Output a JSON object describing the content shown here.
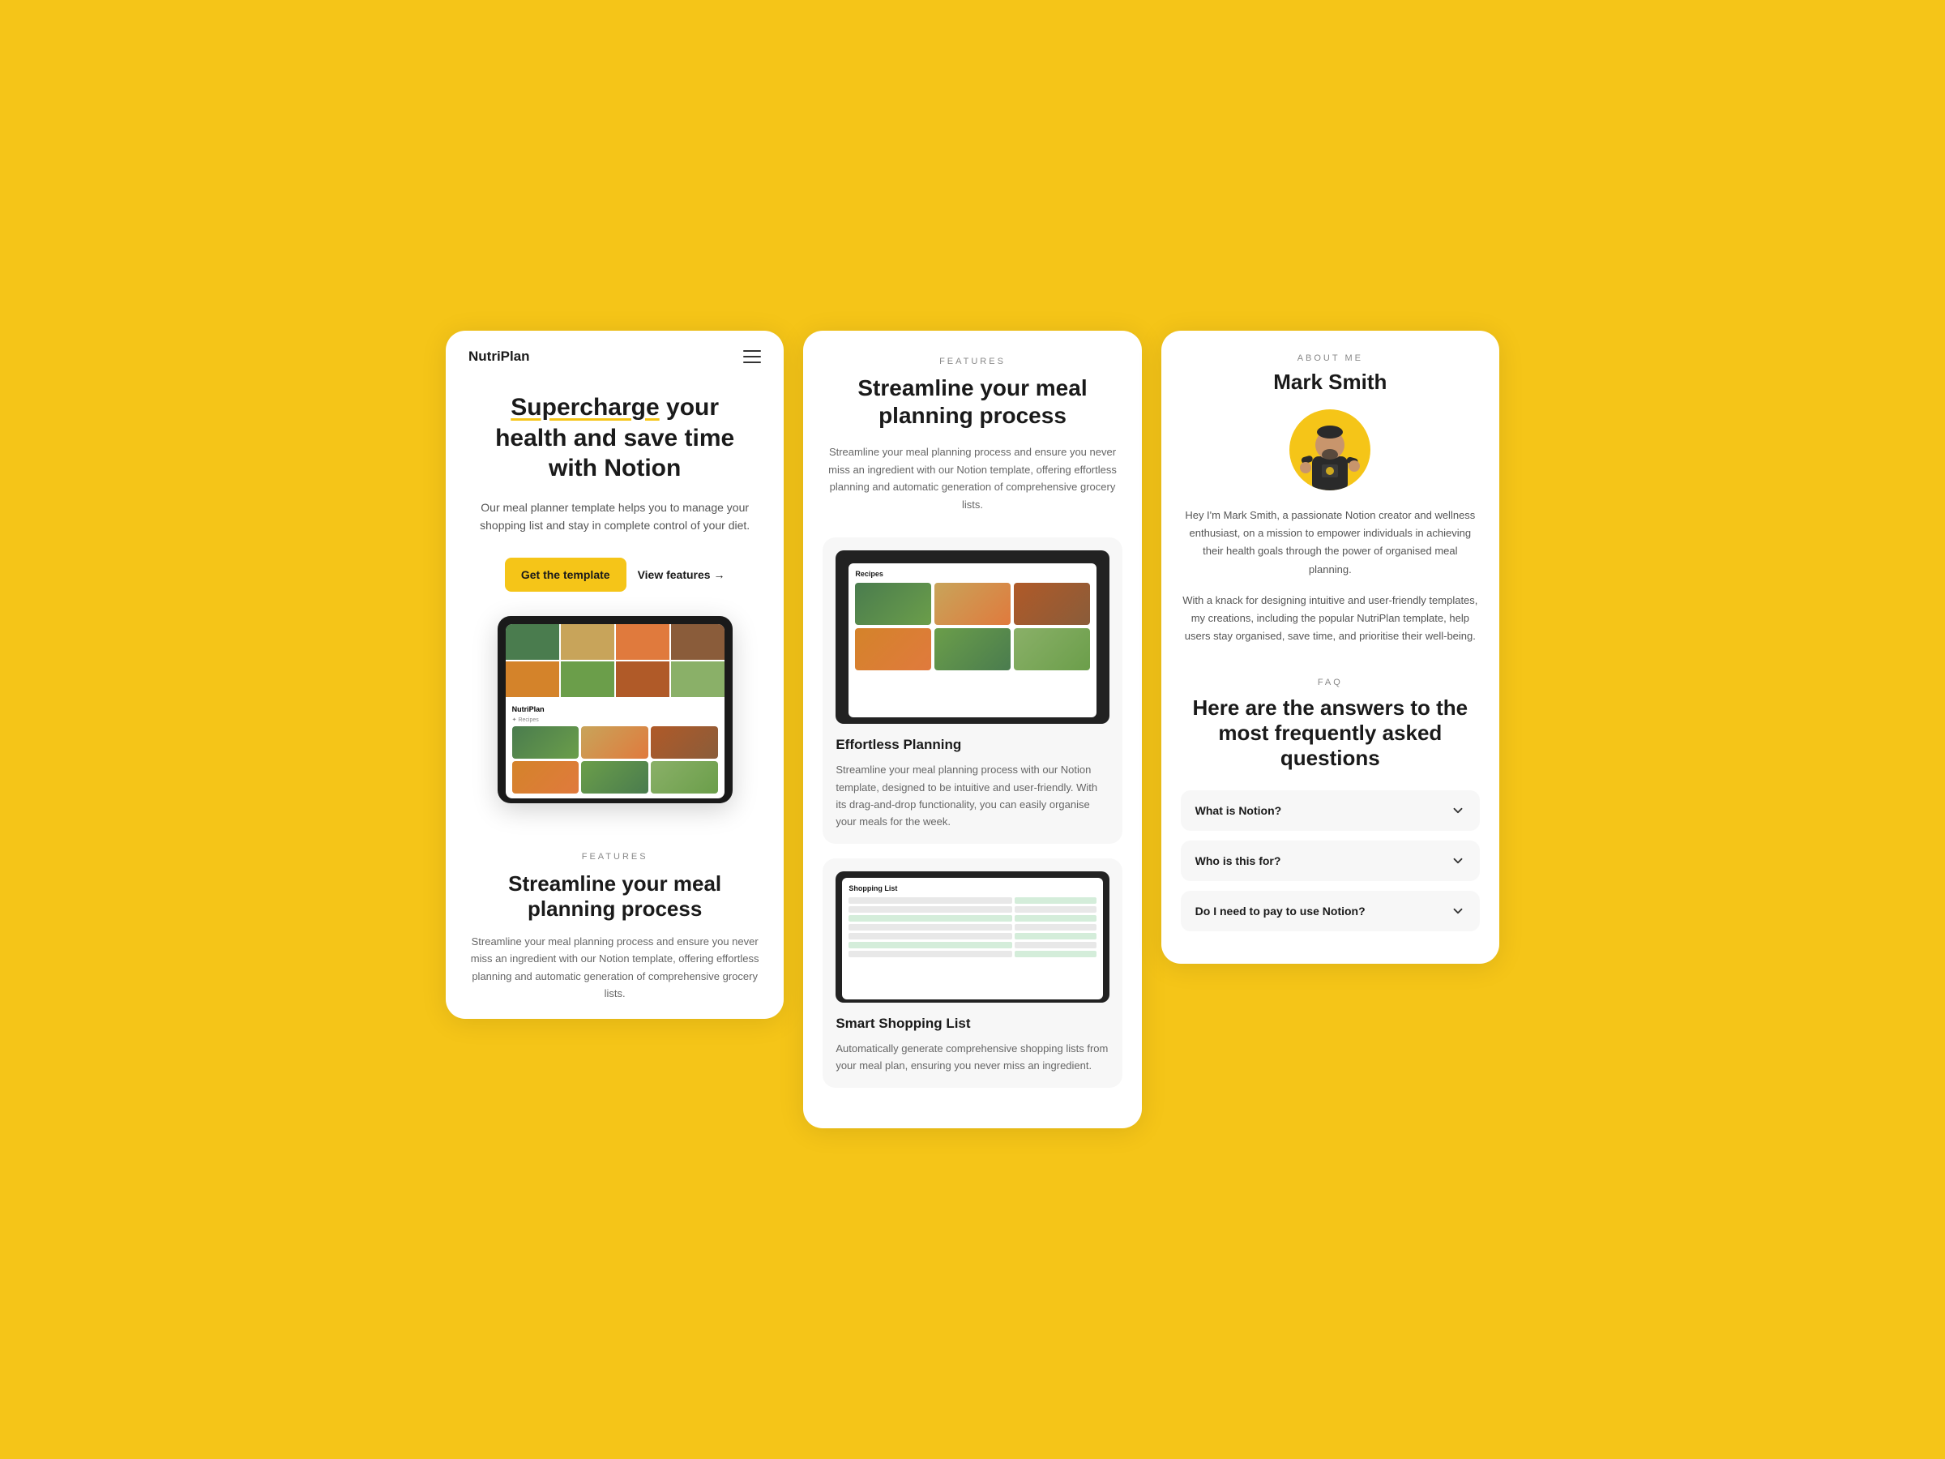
{
  "background_color": "#F5C518",
  "screen1": {
    "logo": "NutriPlan",
    "hero_title_part1": "Supercharge",
    "hero_title_rest": " your health and save time with Notion",
    "hero_description": "Our meal planner template helps you to manage your shopping list  and stay in complete control of your diet.",
    "btn_primary": "Get the template",
    "btn_secondary": "View features →",
    "features_label": "FEATURES",
    "features_title": "Streamline your meal planning process",
    "features_desc": "Streamline your meal planning process and ensure you never miss an ingredient with our Notion template, offering effortless planning and automatic generation of comprehensive grocery lists."
  },
  "screen2": {
    "features_label": "FEATURES",
    "features_title": "Streamline your meal planning process",
    "features_desc": "Streamline your meal planning process and ensure you never miss an ingredient with our Notion template, offering effortless planning and automatic generation of comprehensive grocery lists.",
    "card1_title": "Effortless Planning",
    "card1_desc": "Streamline your meal planning process with our Notion template, designed to be intuitive and user-friendly. With its drag-and-drop functionality, you can easily organise your meals for the week.",
    "card2_title": "Smart Shopping List",
    "card2_desc": "Automatically generate comprehensive shopping lists from your meal plan, ensuring you never miss an ingredient."
  },
  "screen3": {
    "about_label": "ABOUT ME",
    "about_name": "Mark Smith",
    "about_text1": "Hey I'm Mark Smith, a passionate Notion creator and wellness enthusiast, on a mission to empower individuals in achieving their health goals through the power of organised meal planning.",
    "about_text2": "With a knack for designing intuitive and user-friendly templates, my creations, including the popular NutriPlan template, help users stay organised, save time, and prioritise their well-being.",
    "faq_label": "FAQ",
    "faq_title": "Here are the answers to the most frequently asked questions",
    "faq_items": [
      {
        "question": "What is Notion?"
      },
      {
        "question": "Who is this for?"
      },
      {
        "question": "Do I need to pay to use Notion?"
      }
    ]
  }
}
